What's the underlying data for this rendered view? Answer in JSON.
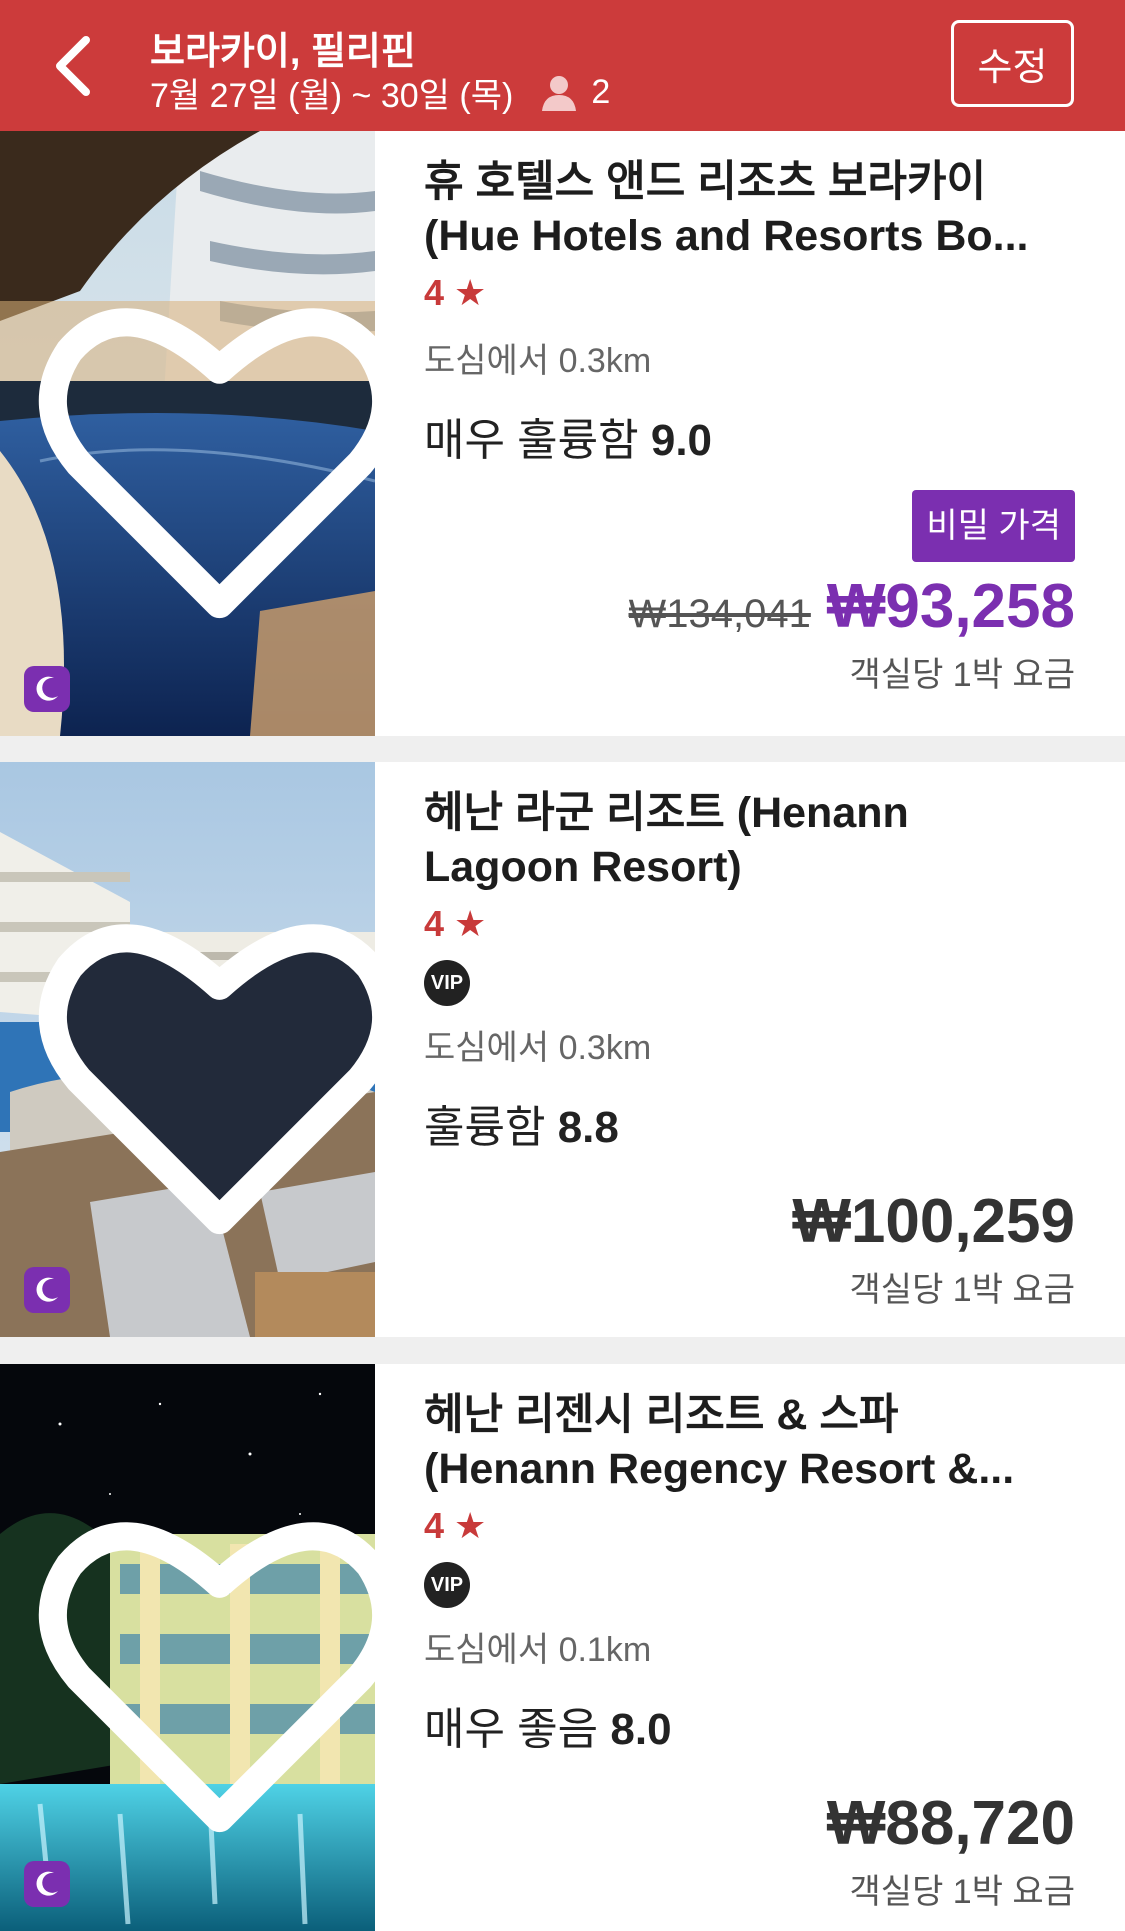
{
  "header": {
    "title": "보라카이, 필리핀",
    "dates": "7월 27일 (월) ~ 30일 (목)",
    "guests": "2",
    "edit_label": "수정"
  },
  "colors": {
    "header_bg": "#cc3b3b",
    "accent_purple": "#7b2fb0",
    "star_red": "#c83a3a"
  },
  "hotels": [
    {
      "name_line1": "휴 호텔스 앤드 리조츠 보라카이",
      "name_line2": "(Hue Hotels and Resorts Bo...",
      "stars": "4",
      "vip": false,
      "distance": "도심에서 0.3km",
      "rating_label": "매우 훌륭함",
      "rating_score": "9.0",
      "badge": "비밀 가격",
      "old_price": "₩134,041",
      "price": "₩93,258",
      "price_note": "객실당 1박 요금",
      "favorited": false
    },
    {
      "name_line1": "헤난 라군 리조트 (Henann",
      "name_line2": "Lagoon Resort)",
      "stars": "4",
      "vip": true,
      "vip_label": "VIP",
      "distance": "도심에서 0.3km",
      "rating_label": "훌륭함",
      "rating_score": "8.8",
      "price": "₩100,259",
      "price_note": "객실당 1박 요금",
      "favorited": true
    },
    {
      "name_line1": "헤난 리젠시 리조트 & 스파",
      "name_line2": "(Henann Regency Resort &...",
      "stars": "4",
      "vip": true,
      "vip_label": "VIP",
      "distance": "도심에서 0.1km",
      "rating_label": "매우 좋음",
      "rating_score": "8.0",
      "price": "₩88,720",
      "price_note": "객실당 1박 요금",
      "favorited": false
    }
  ]
}
